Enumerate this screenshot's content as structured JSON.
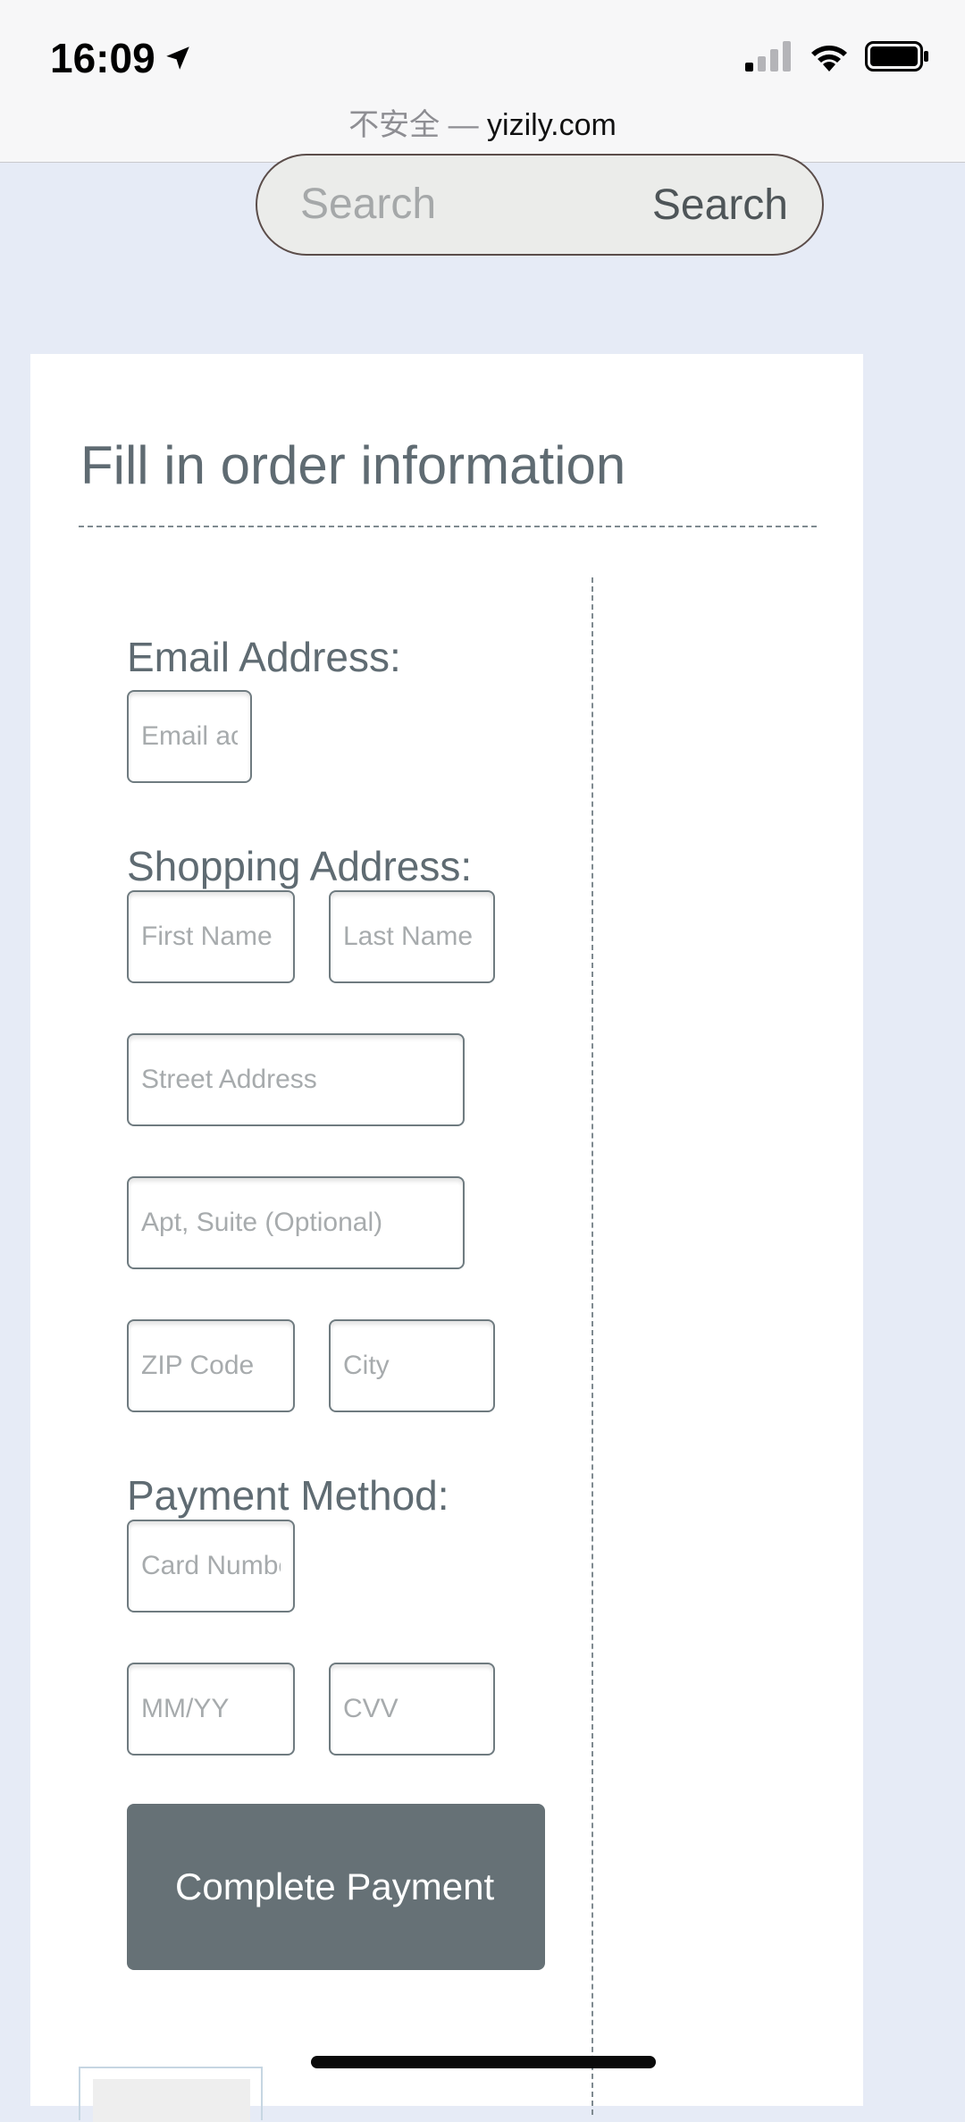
{
  "status_bar": {
    "time": "16:09",
    "url_insecure": "不安全 —",
    "url_domain": "yizily.com"
  },
  "search": {
    "placeholder": "Search",
    "button_label": "Search"
  },
  "form": {
    "title": "Fill in order information",
    "email_label": "Email Address:",
    "email_placeholder": "Email ac",
    "shipping_label": "Shopping Address:",
    "first_name_placeholder": "First Name",
    "last_name_placeholder": "Last Name",
    "street_placeholder": "Street Address",
    "apt_placeholder": "Apt, Suite (Optional)",
    "zip_placeholder": "ZIP Code",
    "city_placeholder": "City",
    "payment_label": "Payment Method:",
    "card_placeholder": "Card Numbe",
    "expiry_placeholder": "MM/YY",
    "cvv_placeholder": "CVV",
    "submit_label": "Complete Payment"
  },
  "icons": [
    "location-arrow-icon",
    "cellular-signal-icon",
    "wifi-icon",
    "battery-icon"
  ],
  "colors": {
    "background": "#e6ebf6",
    "card": "#ffffff",
    "text": "#5f6b72",
    "button": "#667176"
  }
}
